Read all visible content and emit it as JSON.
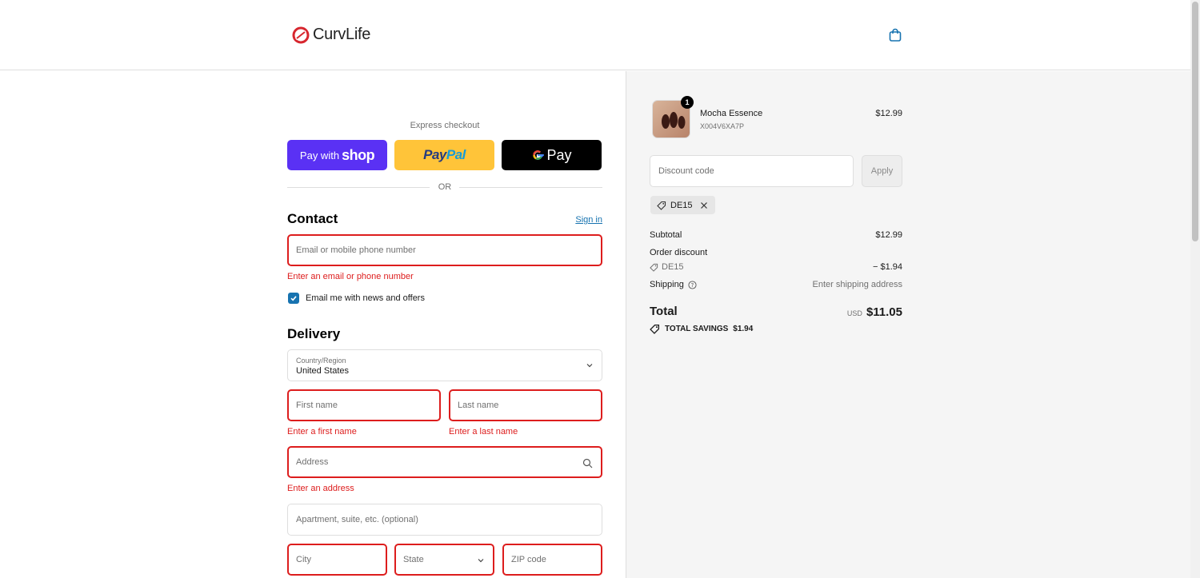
{
  "brand": {
    "name": "CurvLife"
  },
  "icons": {
    "cart": "shopping-bag-icon",
    "logo": "curvlife-logo-icon"
  },
  "colors": {
    "shop": "#5a31f4",
    "paypal": "#ffc439",
    "error": "#dd1d1d",
    "link": "#1773b0"
  },
  "express": {
    "label": "Express checkout",
    "shop_prefix": "Pay with",
    "shop_brand": "shop",
    "paypal_pay": "Pay",
    "paypal_pal": "Pal",
    "gpay_text": "Pay",
    "or_text": "OR"
  },
  "contact": {
    "title": "Contact",
    "sign_in": "Sign in",
    "email_placeholder": "Email or mobile phone number",
    "email_error": "Enter an email or phone number",
    "newsletter_label": "Email me with news and offers",
    "newsletter_checked": true
  },
  "delivery": {
    "title": "Delivery",
    "country_label": "Country/Region",
    "country_value": "United States",
    "first_name_placeholder": "First name",
    "first_name_error": "Enter a first name",
    "last_name_placeholder": "Last name",
    "last_name_error": "Enter a last name",
    "address_placeholder": "Address",
    "address_error": "Enter an address",
    "apartment_placeholder": "Apartment, suite, etc. (optional)",
    "city_placeholder": "City",
    "state_placeholder": "State",
    "zip_placeholder": "ZIP code"
  },
  "summary": {
    "item": {
      "name": "Mocha Essence",
      "sku": "X004V6XA7P",
      "price": "$12.99",
      "quantity": "1"
    },
    "discount_placeholder": "Discount code",
    "apply_label": "Apply",
    "applied_code": "DE15",
    "subtotal_label": "Subtotal",
    "subtotal_value": "$12.99",
    "order_discount_label": "Order discount",
    "discount_code": "DE15",
    "discount_value": "− $1.94",
    "shipping_label": "Shipping",
    "shipping_value": "Enter shipping address",
    "total_label": "Total",
    "currency": "USD",
    "total_value": "$11.05",
    "savings_label": "TOTAL SAVINGS",
    "savings_value": "$1.94"
  }
}
